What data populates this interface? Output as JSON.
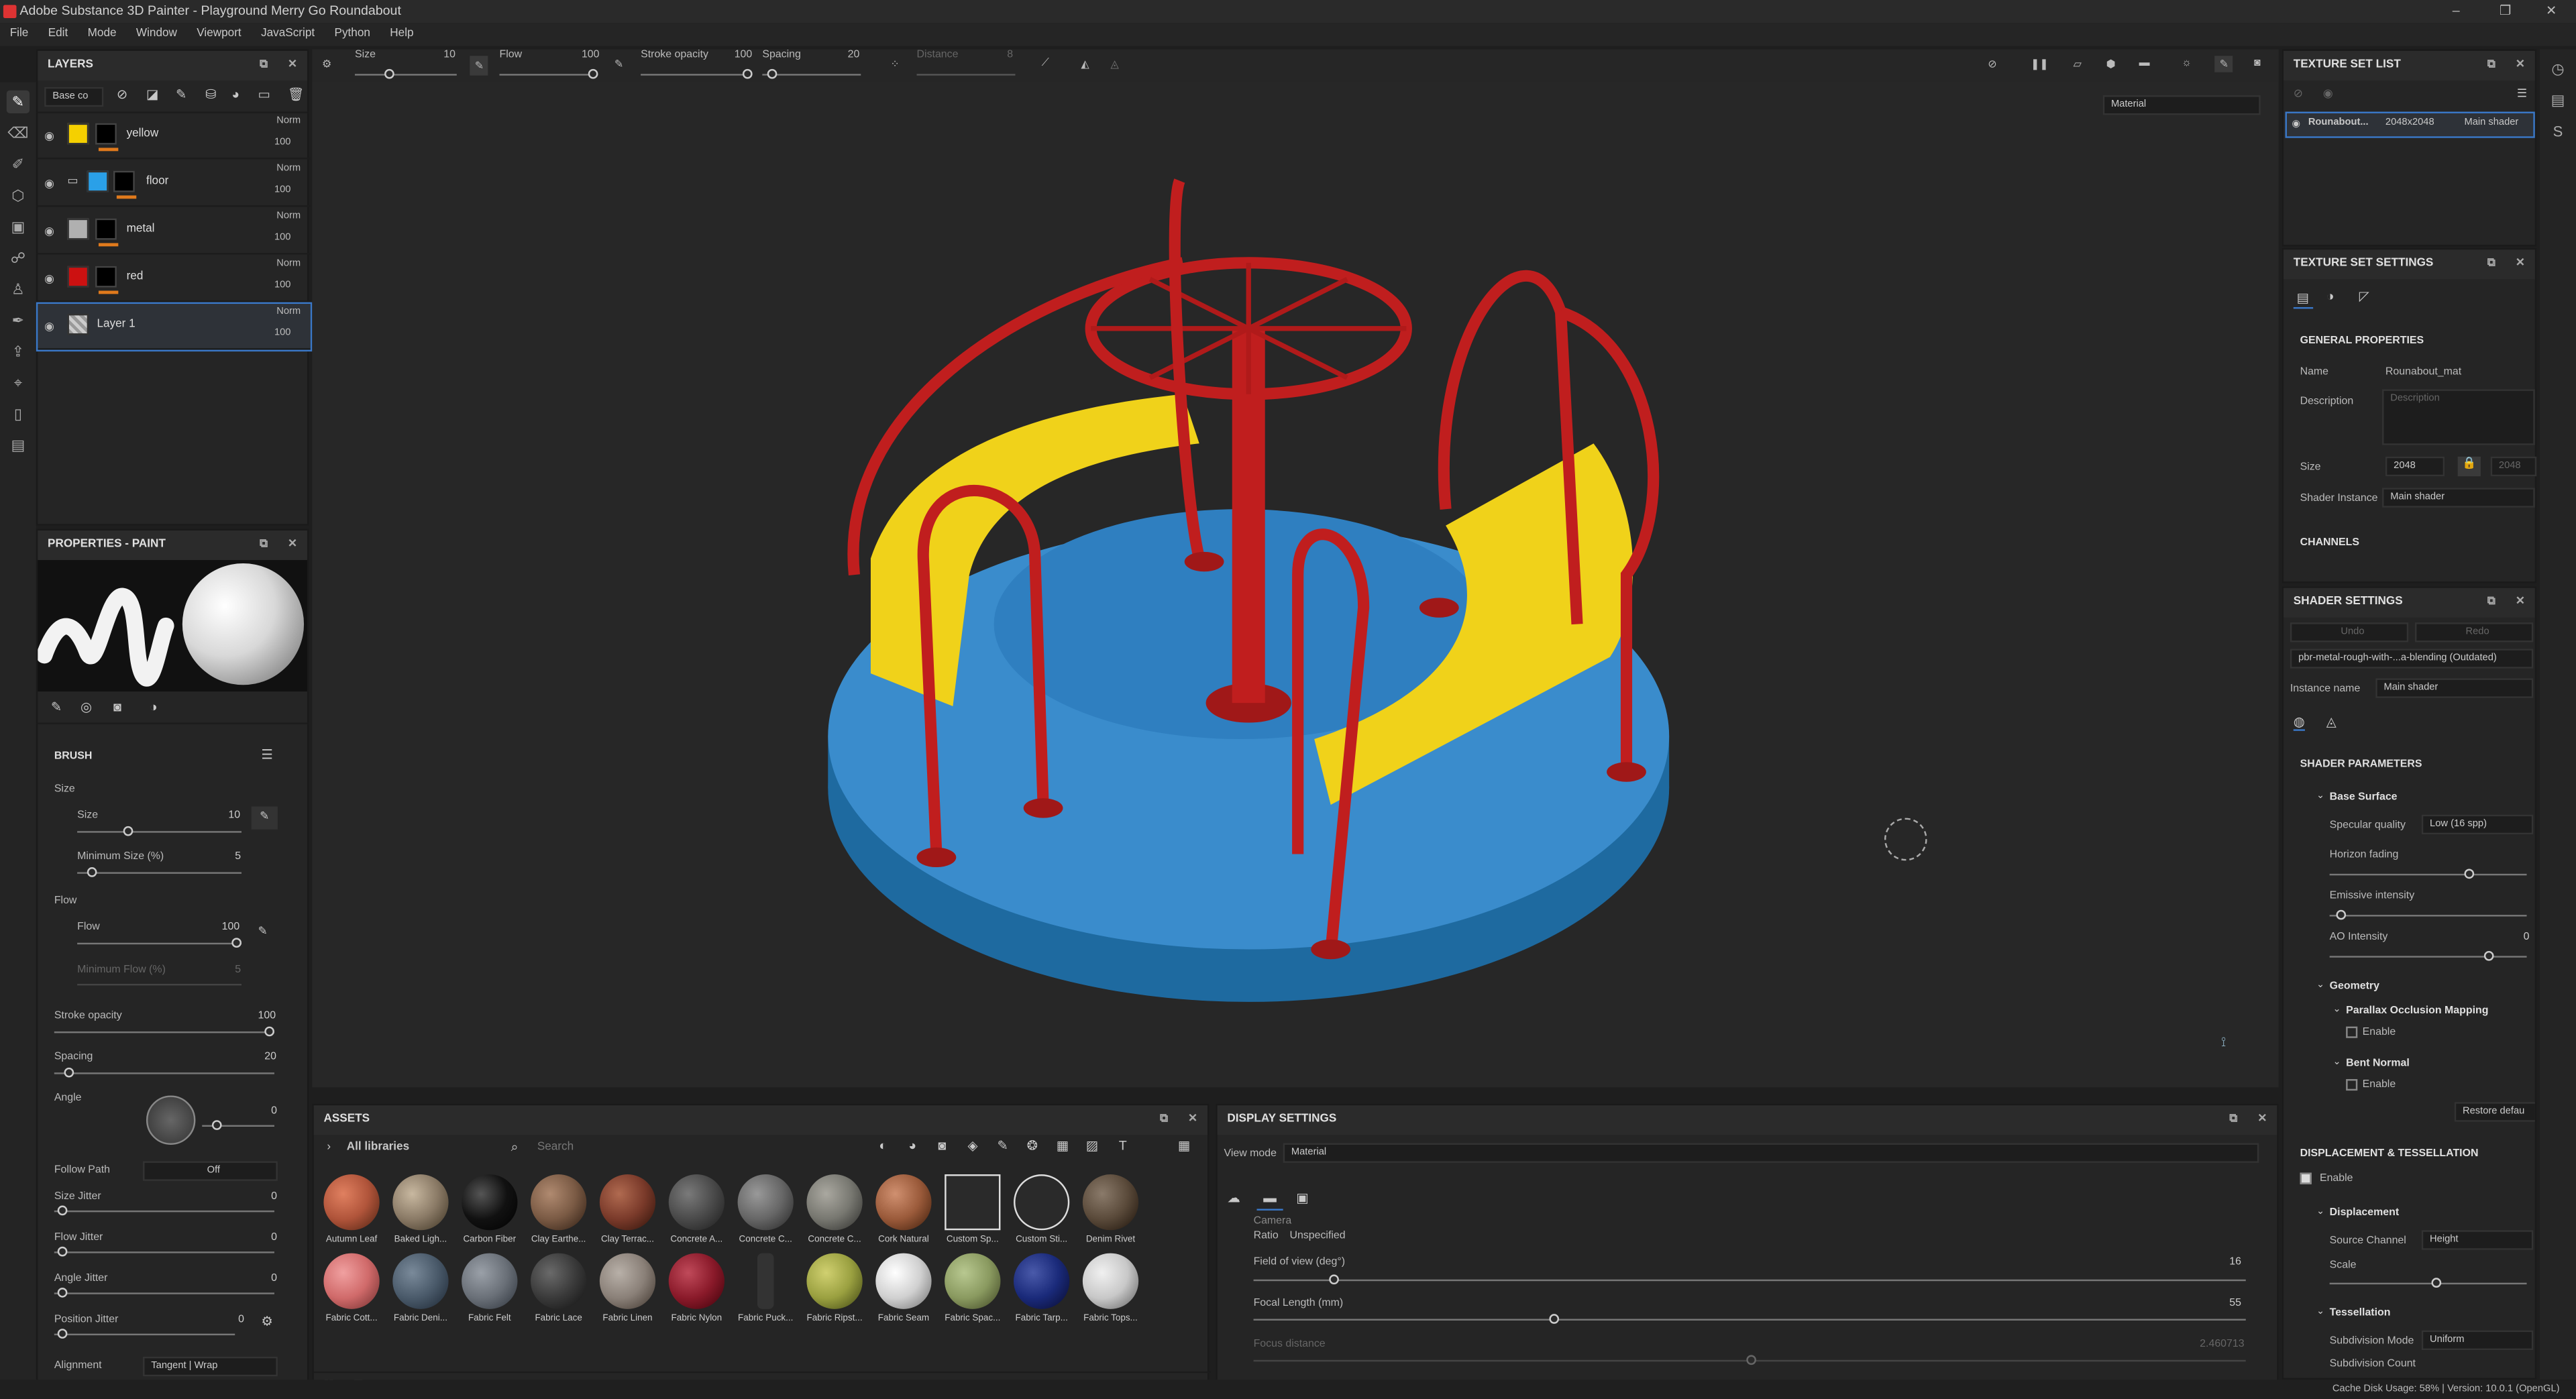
{
  "window": {
    "title": "Adobe Substance 3D Painter - Playground Merry Go Roundabout",
    "controls": [
      "–",
      "❐",
      "✕"
    ]
  },
  "menu": [
    "File",
    "Edit",
    "Mode",
    "Window",
    "Viewport",
    "JavaScript",
    "Python",
    "Help"
  ],
  "toolbar": {
    "size_label": "Size",
    "size_value": "10",
    "flow_label": "Flow",
    "flow_value": "100",
    "stroke_label": "Stroke opacity",
    "stroke_value": "100",
    "spacing_label": "Spacing",
    "spacing_value": "20",
    "distance_label": "Distance",
    "distance_value": "8",
    "view_mode": "Material"
  },
  "layers": {
    "title": "LAYERS",
    "channel": "Base co",
    "items": [
      {
        "name": "yellow",
        "blend": "Norm",
        "opacity": "100",
        "color": "#f5d000"
      },
      {
        "name": "floor",
        "blend": "Norm",
        "opacity": "100",
        "color": "#2aa0e8"
      },
      {
        "name": "metal",
        "blend": "Norm",
        "opacity": "100",
        "color": "#b0b0b0"
      },
      {
        "name": "red",
        "blend": "Norm",
        "opacity": "100",
        "color": "#cc1111"
      },
      {
        "name": "Layer 1",
        "blend": "Norm",
        "opacity": "100",
        "color": "#888888"
      }
    ]
  },
  "properties": {
    "title": "PROPERTIES - PAINT",
    "brush_title": "BRUSH",
    "size_section": "Size",
    "size_label": "Size",
    "size_value": "10",
    "min_size_label": "Minimum Size (%)",
    "min_size_value": "5",
    "flow_section": "Flow",
    "flow_label": "Flow",
    "flow_value": "100",
    "min_flow_label": "Minimum Flow (%)",
    "min_flow_value": "5",
    "stroke_label": "Stroke opacity",
    "stroke_value": "100",
    "spacing_label": "Spacing",
    "spacing_value": "20",
    "angle_label": "Angle",
    "angle_value": "0",
    "follow_label": "Follow Path",
    "follow_value": "Off",
    "size_jitter_label": "Size Jitter",
    "size_jitter_value": "0",
    "flow_jitter_label": "Flow Jitter",
    "flow_jitter_value": "0",
    "angle_jitter_label": "Angle Jitter",
    "angle_jitter_value": "0",
    "position_jitter_label": "Position Jitter",
    "position_jitter_value": "0",
    "alignment_label": "Alignment",
    "alignment_value": "Tangent | Wrap"
  },
  "assets": {
    "title": "ASSETS",
    "library": "All libraries",
    "search_placeholder": "Search",
    "row1": [
      {
        "name": "Autumn Leaf",
        "color": "#b0543a"
      },
      {
        "name": "Baked Ligh...",
        "color": "#8a7a66"
      },
      {
        "name": "Carbon Fiber",
        "color": "#111111"
      },
      {
        "name": "Clay Earthe...",
        "color": "#7a5a44"
      },
      {
        "name": "Clay Terrac...",
        "color": "#7a3a2a"
      },
      {
        "name": "Concrete A...",
        "color": "#4a4a4a"
      },
      {
        "name": "Concrete C...",
        "color": "#666666"
      },
      {
        "name": "Concrete C...",
        "color": "#777770"
      },
      {
        "name": "Cork Natural",
        "color": "#9a5a3a"
      },
      {
        "name": "Custom Sp...",
        "color": "#dddddd"
      },
      {
        "name": "Custom Sti...",
        "color": "#dddddd"
      },
      {
        "name": "Denim Rivet",
        "color": "#5a4a3a"
      }
    ],
    "row2": [
      {
        "name": "Fabric Cott...",
        "color": "#d06a6a"
      },
      {
        "name": "Fabric Deni...",
        "color": "#4a5a6a"
      },
      {
        "name": "Fabric Felt",
        "color": "#6a7078"
      },
      {
        "name": "Fabric Lace",
        "color": "#3a3a3a"
      },
      {
        "name": "Fabric Linen",
        "color": "#8a8078"
      },
      {
        "name": "Fabric Nylon",
        "color": "#8a1a2a"
      },
      {
        "name": "Fabric Puck...",
        "color": "#222222"
      },
      {
        "name": "Fabric Ripst...",
        "color": "#9aa040"
      },
      {
        "name": "Fabric Seam",
        "color": "#d0d0d0"
      },
      {
        "name": "Fabric Spac...",
        "color": "#8a9a60"
      },
      {
        "name": "Fabric Tarp...",
        "color": "#1a2a7a"
      },
      {
        "name": "Fabric Tops...",
        "color": "#c8c8c8"
      }
    ]
  },
  "display": {
    "title": "DISPLAY SETTINGS",
    "view_mode_label": "View mode",
    "view_mode_value": "Material",
    "ratio_label": "Ratio",
    "ratio_value": "Unspecified",
    "fov_label": "Field of view (deg°)",
    "fov_value": "16",
    "focal_label": "Focal Length (mm)",
    "focal_value": "55",
    "focus_label": "Focus distance",
    "focus_value": "2.460713",
    "camera_label": "Camera"
  },
  "texture_set_list": {
    "title": "TEXTURE SET LIST",
    "item": "Rounabout...",
    "size": "2048x2048",
    "shader": "Main shader"
  },
  "texture_set_settings": {
    "title": "TEXTURE SET SETTINGS",
    "general": "GENERAL PROPERTIES",
    "name_label": "Name",
    "name_value": "Rounabout_mat",
    "desc_label": "Description",
    "desc_placeholder": "Description",
    "size_label": "Size",
    "size_value": "2048",
    "size_value2": "2048",
    "shader_label": "Shader Instance",
    "shader_value": "Main shader",
    "channels": "CHANNELS"
  },
  "shader_settings": {
    "title": "SHADER SETTINGS",
    "undo": "Undo",
    "redo": "Redo",
    "shader_name": "pbr-metal-rough-with-...a-blending (Outdated)",
    "instance_label": "Instance name",
    "instance_value": "Main shader",
    "params": "SHADER PARAMETERS",
    "base_surface": "Base Surface",
    "specular_label": "Specular quality",
    "specular_value": "Low (16 spp)",
    "horizon_label": "Horizon fading",
    "emissive_label": "Emissive intensity",
    "ao_label": "AO Intensity",
    "ao_value": "0",
    "geometry": "Geometry",
    "pom": "Parallax Occlusion Mapping",
    "enable1": "Enable",
    "bent": "Bent Normal",
    "enable2": "Enable",
    "restore": "Restore defau",
    "disp_tess": "DISPLACEMENT & TESSELLATION",
    "enable3": "Enable",
    "displacement": "Displacement",
    "source_label": "Source Channel",
    "source_value": "Height",
    "scale_label": "Scale",
    "tessellation": "Tessellation",
    "subdiv_label": "Subdivision Mode",
    "subdiv_value": "Uniform",
    "subdiv_count": "Subdivision Count"
  },
  "status": "Cache Disk Usage:   58%  |  Version: 10.0.1 (OpenGL)"
}
